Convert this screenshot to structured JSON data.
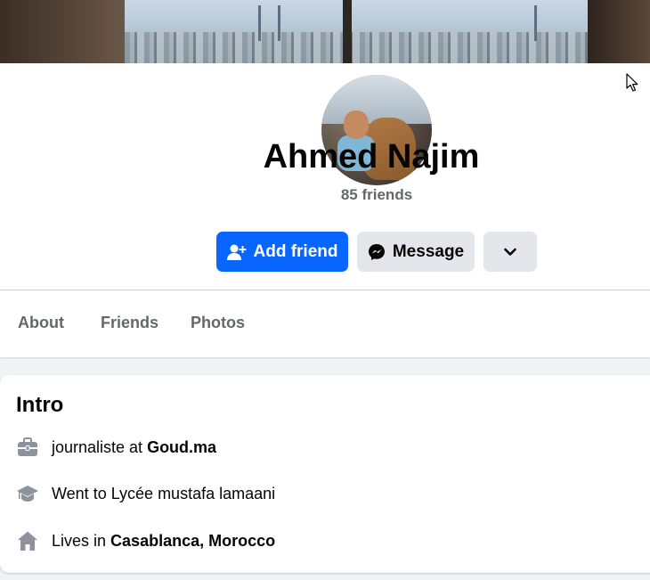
{
  "profile": {
    "name": "Ahmed Najim",
    "friends_count": "85 friends"
  },
  "actions": {
    "add_friend_label": "Add friend",
    "message_label": "Message"
  },
  "tabs": [
    {
      "label": "About"
    },
    {
      "label": "Friends"
    },
    {
      "label": "Photos"
    }
  ],
  "intro": {
    "title": "Intro",
    "work": {
      "prefix": "journaliste at ",
      "place": "Goud.ma"
    },
    "education": {
      "text": "Went to Lycée mustafa lamaani"
    },
    "location": {
      "prefix": "Lives in ",
      "place": "Casablanca, Morocco"
    }
  },
  "icons": {
    "add_friend": "person-add-icon",
    "message": "messenger-icon",
    "more": "chevron-down-icon",
    "work": "briefcase-icon",
    "education": "graduation-cap-icon",
    "location": "home-icon"
  },
  "colors": {
    "primary": "#0866ff",
    "secondary_button": "#e4e6eb",
    "muted_text": "#65676b",
    "background": "#f0f2f5"
  }
}
